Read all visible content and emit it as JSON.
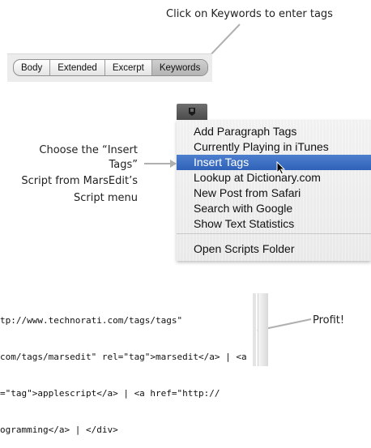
{
  "annotations": {
    "keywords_hint": "Click on Keywords to enter tags",
    "script_hint_line1": "Choose the “Insert Tags”",
    "script_hint_line2": "Script from MarsEdit’s",
    "script_hint_line3": "Script menu",
    "profit": "Profit!"
  },
  "tabs": [
    {
      "label": "Body",
      "active": false
    },
    {
      "label": "Extended",
      "active": false
    },
    {
      "label": "Excerpt",
      "active": false
    },
    {
      "label": "Keywords",
      "active": true
    }
  ],
  "script_menu": {
    "icon": "script-icon",
    "items": [
      {
        "label": "Add Paragraph Tags",
        "selected": false
      },
      {
        "label": "Currently Playing in iTunes",
        "selected": false
      },
      {
        "label": "Insert Tags",
        "selected": true
      },
      {
        "label": "Lookup at Dictionary.com",
        "selected": false
      },
      {
        "label": "New Post from Safari",
        "selected": false
      },
      {
        "label": "Search with Google",
        "selected": false
      },
      {
        "label": "Show Text Statistics",
        "selected": false
      }
    ],
    "footer_item": "Open Scripts Folder"
  },
  "code_lines": [
    "tp://www.technorati.com/tags/tags\"",
    "com/tags/marsedit\" rel=\"tag\">marsedit</a> | <a",
    "=\"tag\">applescript</a> | <a href=\"http://",
    "ogramming</a> | </div>"
  ],
  "colors": {
    "selection": "#3d6fc0",
    "code_tag": "#1b3fa0"
  }
}
